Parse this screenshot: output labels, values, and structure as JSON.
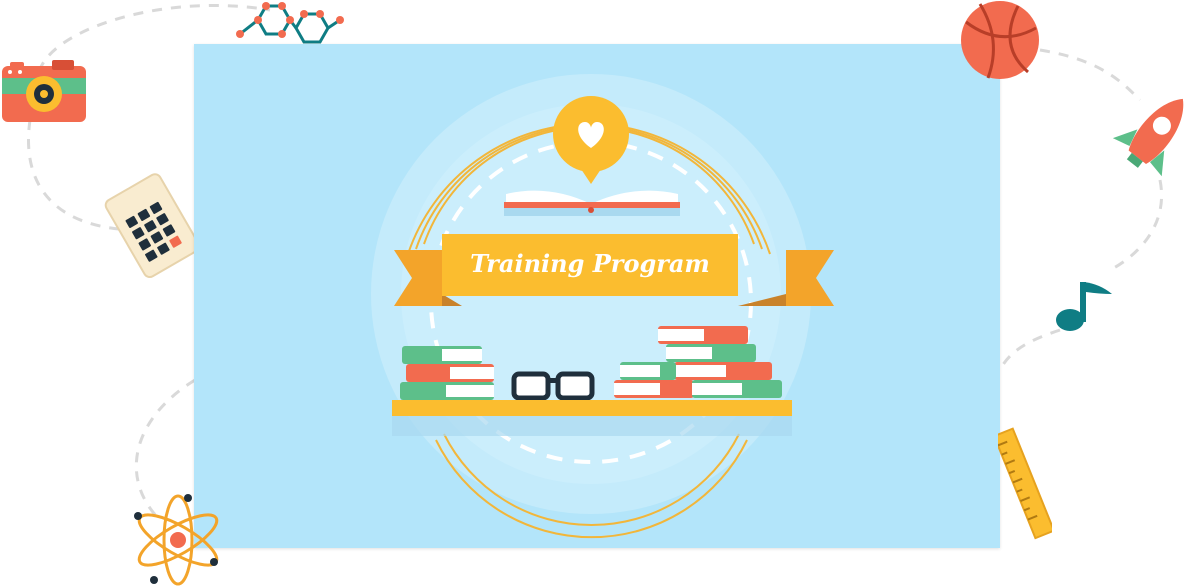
{
  "banner": {
    "title": "Training Program"
  },
  "colors": {
    "panel": "#b3e5fa",
    "ribbon": "#fbbd2f",
    "ribbon_dark": "#f3a42a",
    "coral": "#f26b4f",
    "green": "#5dbf8a",
    "dark_teal": "#0f7d84",
    "dash": "#d8d8d8"
  },
  "icons": [
    "camera-icon",
    "molecule-icon",
    "calculator-icon",
    "basketball-icon",
    "rocket-icon",
    "music-note-icon",
    "ruler-icon",
    "atom-icon",
    "heart-bubble-icon",
    "open-book-icon",
    "glasses-icon",
    "book-stack-icon",
    "shelf-icon"
  ]
}
